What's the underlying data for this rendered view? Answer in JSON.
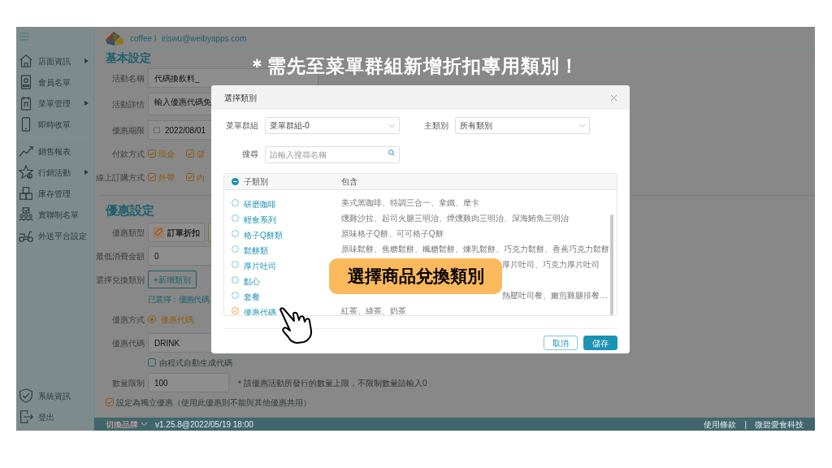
{
  "annotation": "＊需先至菜單群組新增折扣專用類別！",
  "callout": "選擇商品兌換類別",
  "header": {
    "store": "coffee I",
    "account": "iriswu@weibyapps.com"
  },
  "sidebar": {
    "items": [
      {
        "label": "店面資訊",
        "kind": "house",
        "submenu": true
      },
      {
        "label": "會員名單",
        "kind": "card",
        "submenu": false
      },
      {
        "label": "菜單管理",
        "kind": "menu",
        "submenu": true
      },
      {
        "label": "即時收單",
        "kind": "phone",
        "submenu": false
      },
      {
        "label": "銷售報表",
        "kind": "chart",
        "submenu": false
      },
      {
        "label": "行銷活動",
        "kind": "star",
        "submenu": true
      },
      {
        "label": "庫存管理",
        "kind": "boxes",
        "submenu": false
      },
      {
        "label": "實聯制名單",
        "kind": "people",
        "submenu": false
      },
      {
        "label": "外送平台設定",
        "kind": "scooter",
        "submenu": false
      }
    ],
    "bottom_items": [
      {
        "label": "系統資訊",
        "kind": "shield"
      },
      {
        "label": "登出",
        "kind": "logout"
      }
    ]
  },
  "basic_section": {
    "title": "基本設定",
    "rows": [
      {
        "kind": "input",
        "label": "活動名稱",
        "value": "代碼換飲料_"
      },
      {
        "kind": "textarea",
        "label": "活動詳情",
        "value": "輸入優惠代碼免"
      },
      {
        "kind": "date",
        "label": "優惠期限",
        "value": "2022/08/01"
      },
      {
        "kind": "checks",
        "label": "付款方式",
        "options": [
          {
            "label": "現金",
            "checked": true
          },
          {
            "label": "儲",
            "checked": true
          }
        ]
      },
      {
        "kind": "checks",
        "label": "線上訂購方式",
        "options": [
          {
            "label": "外帶",
            "checked": true
          },
          {
            "label": "內",
            "checked": true
          }
        ]
      }
    ]
  },
  "discount_section": {
    "title": "優惠設定",
    "rows": [
      {
        "kind": "type",
        "label": "優惠類型",
        "value": "訂單折扣"
      },
      {
        "kind": "input",
        "label": "最低消費金額",
        "value": "0"
      },
      {
        "kind": "add",
        "label": "選擇兌換類別",
        "value": "+新增類別",
        "note": "已選擇：優惠代碼"
      },
      {
        "kind": "radio",
        "label": "優惠方式",
        "options": [
          {
            "label": "優惠代碼",
            "selected": true
          }
        ]
      },
      {
        "kind": "input",
        "label": "優惠代碼",
        "value": "DRINK",
        "checkbox": {
          "label": "由程式自動生成代碼",
          "checked": false
        }
      },
      {
        "kind": "input",
        "label": "數量限制",
        "value": "100",
        "hint": "＊該優惠活動所發行的數量上限，不限制數量請輸入0"
      }
    ],
    "exclusive": {
      "label": "設定為獨立優惠（使用此優惠則不能與其他優惠共用）",
      "checked": true
    }
  },
  "footer": {
    "brand": "切換品牌",
    "version": "v1.25.8@2022/05/19 18:00",
    "links": [
      "使用條款",
      "|",
      "微碧愛食科技"
    ]
  },
  "modal": {
    "title": "選擇類別",
    "menu_group": {
      "label": "菜單群組",
      "value": "菜單群組-0"
    },
    "main_category": {
      "label": "主類別",
      "value": "所有類別"
    },
    "search": {
      "label": "搜尋",
      "placeholder": "請輸入搜尋名稱"
    },
    "table": {
      "select_all_partial": true,
      "columns": [
        "子類別",
        "包含"
      ],
      "rows": [
        {
          "name": "研磨咖啡",
          "includes": "美式黑咖啡、特調三合一、拿鐵、摩卡",
          "selected": false
        },
        {
          "name": "輕食系列",
          "includes": "燻雞沙拉、起司火腿三明治、煙燻雞肉三明治、深海鮪魚三明治",
          "selected": false
        },
        {
          "name": "格子Q餅類",
          "includes": "原味格子Q餅、可可格子Q餅",
          "selected": false
        },
        {
          "name": "鬆餅類",
          "includes": "原味鬆餅、焦糖鬆餅、楓糖鬆餅、煉乳鬆餅、巧克力鬆餅、香蕉巧克力鬆餅",
          "selected": false
        },
        {
          "name": "厚片吐司",
          "includes": "厚片吐司、巧克力厚片吐司",
          "selected": false,
          "covered": true
        },
        {
          "name": "點心",
          "selected": false
        },
        {
          "name": "套餐",
          "includes": "熱壓吐司餐、嫩煎雞腿排餐…",
          "selected": false,
          "covered": true
        },
        {
          "name": "優惠代碼",
          "includes": "紅茶、綠茶、奶茶",
          "selected": true
        }
      ]
    },
    "buttons": [
      {
        "label": "取消",
        "kind": "secondary"
      },
      {
        "label": "儲存",
        "kind": "primary"
      }
    ]
  }
}
